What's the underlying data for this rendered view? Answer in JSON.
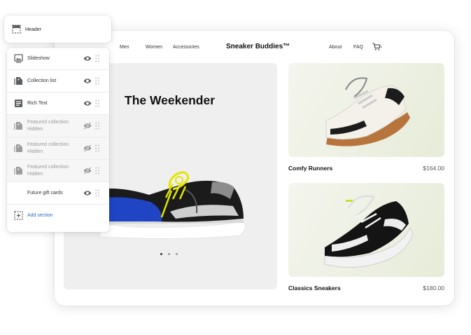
{
  "header_card": {
    "label": "Header",
    "icon": "header-layout-icon"
  },
  "sections": [
    {
      "label": "Slideshow",
      "sublabel": "",
      "icon": "slideshow-icon",
      "hidden": false
    },
    {
      "label": "Collection list",
      "sublabel": "",
      "icon": "collection-tag-icon",
      "hidden": false
    },
    {
      "label": "Rich Text",
      "sublabel": "",
      "icon": "rich-text-icon",
      "hidden": false
    },
    {
      "label": "Featured collection",
      "sublabel": "Hidden",
      "icon": "collection-tag-icon",
      "hidden": true
    },
    {
      "label": "Featured collection",
      "sublabel": "Hidden",
      "icon": "collection-tag-icon",
      "hidden": true
    },
    {
      "label": "Featured collection",
      "sublabel": "Hidden",
      "icon": "collection-tag-icon",
      "hidden": true
    },
    {
      "label": "Future gift cards",
      "sublabel": "",
      "icon": "",
      "hidden": false
    }
  ],
  "add_section": {
    "label": "Add section",
    "icon": "add-section-icon"
  },
  "store": {
    "nav": {
      "men": "Men",
      "women": "Women",
      "accessories": "Accessories",
      "about": "About",
      "faq": "FAQ"
    },
    "brand": "Sneaker Buddies™",
    "hero": {
      "title": "The Weekender",
      "slide_count": 3,
      "active_slide": 1
    },
    "products": [
      {
        "name": "Comfy Runners",
        "price": "$164.00"
      },
      {
        "name": "Classics Sneakers",
        "price": "$180.00"
      }
    ]
  },
  "colors": {
    "accent_link": "#2c6ecb",
    "hero_bg": "#efefef",
    "product_bg": "#e7ecd9"
  }
}
